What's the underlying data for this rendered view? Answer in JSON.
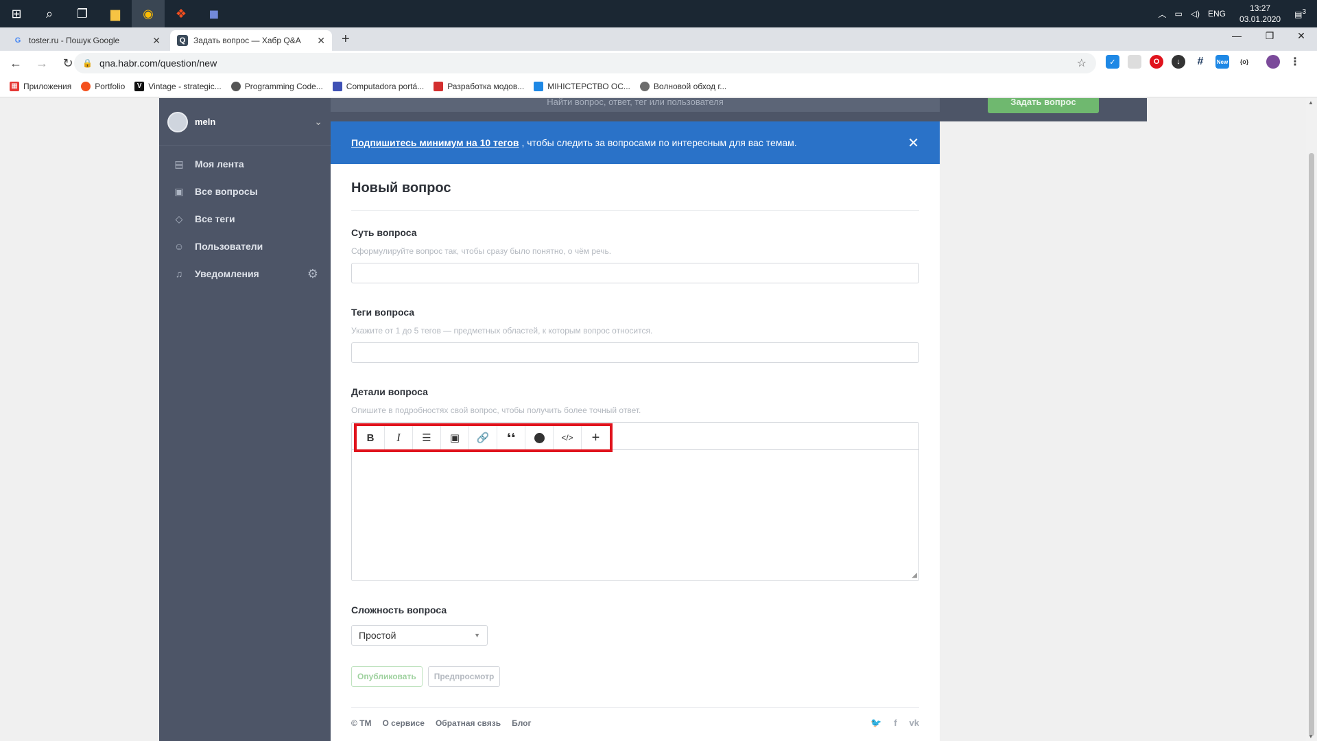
{
  "taskbar": {
    "start_icon": "windows-icon",
    "apps": [
      "search-icon",
      "task-view-icon",
      "file-explorer-icon",
      "chrome-icon",
      "figma-icon",
      "discord-icon"
    ],
    "lang": "ENG",
    "time": "13:27",
    "date": "03.01.2020",
    "notification_count": "3"
  },
  "browser": {
    "tabs": [
      {
        "title": "toster.ru - Пошук Google",
        "favicon": "G"
      },
      {
        "title": "Задать вопрос — Хабр Q&A",
        "favicon": "Q"
      }
    ],
    "url": "qna.habr.com/question/new",
    "bookmarks": [
      {
        "label": "Приложения",
        "color": "#e53935",
        "icon": "apps-grid-icon"
      },
      {
        "label": "Portfolio",
        "color": "#f4511e",
        "icon": "portfolio-icon"
      },
      {
        "label": "Vintage - strategic...",
        "color": "#111111",
        "icon": "vintage-icon"
      },
      {
        "label": "Programming Code...",
        "color": "#555555",
        "icon": "programming-icon"
      },
      {
        "label": "Computadora portá...",
        "color": "#3f51b5",
        "icon": "computer-icon"
      },
      {
        "label": "Разработка модов...",
        "color": "#d32f2f",
        "icon": "mods-icon"
      },
      {
        "label": "МІНІСТЕРСТВО ОС...",
        "color": "#1e88e5",
        "icon": "document-icon"
      },
      {
        "label": "Волновой обход г...",
        "color": "#6d6d6d",
        "icon": "wave-icon"
      }
    ]
  },
  "site": {
    "search_placeholder": "Найти вопрос, ответ, тег или пользователя",
    "ask_button": "Задать вопрос",
    "username": "meln",
    "nav": [
      {
        "label": "Моя лента",
        "icon": "feed-icon"
      },
      {
        "label": "Все вопросы",
        "icon": "questions-icon"
      },
      {
        "label": "Все теги",
        "icon": "tag-icon"
      },
      {
        "label": "Пользователи",
        "icon": "users-icon"
      },
      {
        "label": "Уведомления",
        "icon": "bell-icon"
      }
    ],
    "banner": {
      "link": "Подпишитесь минимум на 10 тегов",
      "text": ", чтобы следить за вопросами по интересным для вас темам."
    },
    "form": {
      "title": "Новый вопрос",
      "summary_label": "Суть вопроса",
      "summary_hint": "Сформулируйте вопрос так, чтобы сразу было понятно, о чём речь.",
      "tags_label": "Теги вопроса",
      "tags_hint": "Укажите от 1 до 5 тегов — предметных областей, к которым вопрос относится.",
      "details_label": "Детали вопроса",
      "details_hint": "Опишите в подробностях свой вопрос, чтобы получить более точный ответ.",
      "editor_tools": [
        {
          "name": "bold-icon",
          "glyph": "B"
        },
        {
          "name": "italic-icon",
          "glyph": "I"
        },
        {
          "name": "list-icon",
          "glyph": "☰"
        },
        {
          "name": "image-icon",
          "glyph": "▣"
        },
        {
          "name": "link-icon",
          "glyph": "🔗"
        },
        {
          "name": "quote-icon",
          "glyph": "❛❛"
        },
        {
          "name": "spoiler-icon",
          "glyph": ""
        },
        {
          "name": "code-icon",
          "glyph": "</>"
        },
        {
          "name": "plus-icon",
          "glyph": "+"
        }
      ],
      "complexity_label": "Сложность вопроса",
      "complexity_value": "Простой",
      "publish_button": "Опубликовать",
      "preview_button": "Предпросмотр"
    },
    "footer": {
      "links": [
        "© ТМ",
        "О сервисе",
        "Обратная связь",
        "Блог"
      ],
      "social": [
        "twitter-icon",
        "facebook-icon",
        "vk-icon"
      ]
    },
    "colors": {
      "sidebar": "#4d5567",
      "banner": "#2a72c8",
      "accent_green": "#6fb86f",
      "highlight_box": "#e0131d"
    }
  }
}
